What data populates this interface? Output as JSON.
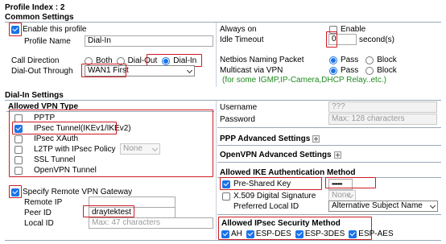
{
  "profile_index": "Profile Index : 2",
  "common": {
    "header": "Common Settings",
    "enable_profile": {
      "label": "Enable this profile",
      "checked": true
    },
    "profile_name": {
      "label": "Profile Name",
      "value": "Dial-In"
    },
    "call_direction": {
      "label": "Call Direction",
      "options": [
        "Both",
        "Dial-Out",
        "Dial-In"
      ],
      "selected": "Dial-In"
    },
    "dial_out_through": {
      "label": "Dial-Out Through",
      "value": "WAN1 First"
    },
    "always_on": {
      "label": "Always on",
      "enable_label": "Enable",
      "checked": false
    },
    "idle_timeout": {
      "label": "Idle Timeout",
      "value": "0",
      "unit": "second(s)"
    },
    "netbios": {
      "label": "Netbios Naming Packet",
      "options": [
        "Pass",
        "Block"
      ],
      "selected": "Pass"
    },
    "multicast": {
      "label": "Multicast via VPN",
      "options": [
        "Pass",
        "Block"
      ],
      "selected": "Pass",
      "note": "(for some IGMP,IP-Camera,DHCP Relay..etc.)"
    }
  },
  "dialin": {
    "header": "Dial-In Settings",
    "allowed_vpn_type": {
      "header": "Allowed VPN Type",
      "pptp": {
        "label": "PPTP",
        "checked": false
      },
      "ipsec": {
        "label": "IPsec Tunnel(IKEv1/IKEv2)",
        "checked": true
      },
      "ipsec_xauth": {
        "label": "IPsec XAuth",
        "checked": false
      },
      "l2tp": {
        "label": "L2TP with IPsec Policy",
        "checked": false,
        "select": "None"
      },
      "ssl": {
        "label": "SSL Tunnel",
        "checked": false
      },
      "openvpn": {
        "label": "OpenVPN Tunnel",
        "checked": false
      }
    },
    "remote_gateway": {
      "label": "Specify Remote VPN Gateway",
      "checked": true,
      "remote_ip": {
        "label": "Remote IP",
        "value": ""
      },
      "peer_id": {
        "label": "Peer ID",
        "value": "draytektest"
      },
      "local_id": {
        "label": "Local ID",
        "placeholder": "Max: 47 characters"
      }
    },
    "username": {
      "label": "Username",
      "placeholder": "???"
    },
    "password": {
      "label": "Password",
      "placeholder": "Max: 128 characters"
    },
    "ppp_advanced": "PPP Advanced Settings",
    "openvpn_advanced": "OpenVPN Advanced Settings",
    "ike_auth": {
      "header": "Allowed IKE Authentication Method",
      "psk": {
        "label": "Pre-Shared Key",
        "checked": true,
        "value": "•••••••"
      },
      "x509": {
        "label": "X.509 Digital Signature",
        "checked": false,
        "select": "None"
      },
      "preferred_local_id": {
        "label": "Preferred Local ID",
        "select": "Alternative Subject Name"
      }
    },
    "ipsec_security": {
      "header": "Allowed IPsec Security Method",
      "methods": [
        {
          "label": "AH",
          "checked": true
        },
        {
          "label": "ESP-DES",
          "checked": true
        },
        {
          "label": "ESP-3DES",
          "checked": true
        },
        {
          "label": "ESP-AES",
          "checked": true
        }
      ]
    }
  },
  "colors": {
    "highlight": "#cc1b24",
    "accent": "#1a73e8",
    "note": "#1f8a1f",
    "rule": "#9aa8b8"
  }
}
